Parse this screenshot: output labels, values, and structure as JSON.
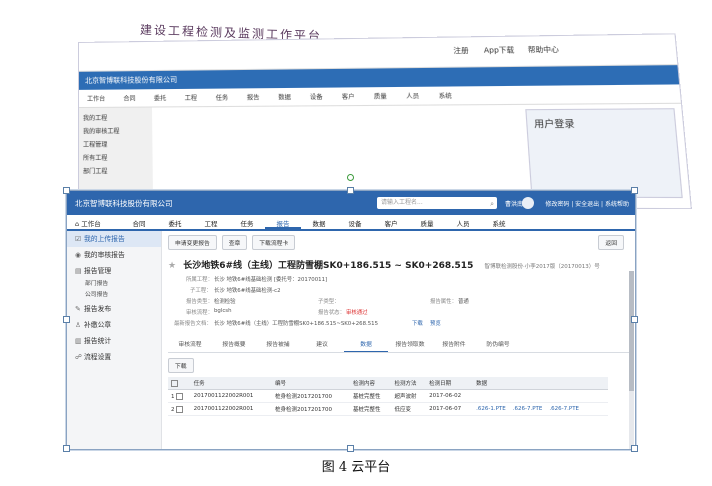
{
  "handwritten_title": "建设工程检测及监测工作平台",
  "background": {
    "company": "北京智博联科技股份有限公司",
    "top_links": [
      "注册",
      "App下载",
      "帮助中心"
    ],
    "nav": [
      "工作台",
      "合同",
      "委托",
      "工程",
      "任务",
      "报告",
      "数据",
      "设备",
      "客户",
      "质量",
      "人员",
      "系统"
    ],
    "side": [
      "我的工程",
      "我的审核工程",
      "工程管理",
      "所有工程",
      "部门工程"
    ],
    "login_title": "用户登录"
  },
  "app": {
    "company": "北京智博联科技股份有限公司",
    "search_placeholder": "请输入工程名...",
    "user": "曹洪南",
    "header_links": "修改密码 | 安全退出 | 系统帮助",
    "nav": [
      "工作台",
      "合同",
      "委托",
      "工程",
      "任务",
      "报告",
      "数据",
      "设备",
      "客户",
      "质量",
      "人员",
      "系统"
    ],
    "nav_active": "报告",
    "side": [
      {
        "label": "我的上传报告",
        "icon": "☑",
        "active": true
      },
      {
        "label": "我的审核报告",
        "icon": "◉"
      },
      {
        "label": "报告管理",
        "icon": "▤"
      },
      {
        "label": "部门报告",
        "sub": true
      },
      {
        "label": "公司报告",
        "sub": true
      },
      {
        "label": "报告发布",
        "icon": "✎"
      },
      {
        "label": "补缴公章",
        "icon": "♙"
      },
      {
        "label": "报告统计",
        "icon": "▥"
      },
      {
        "label": "流程设置",
        "icon": "☍"
      }
    ],
    "buttons": [
      "申请变更报告",
      "查章",
      "下载流程卡"
    ],
    "back_label": "返回",
    "title": "长沙地铁6#线（主线）工程防雪棚SK0+186.515 ~ SK0+268.515",
    "title_meta": "智博联检测股份·小李2017版（20170013）号",
    "info": {
      "project_label": "所属工程：",
      "project_value": "长沙 地铁6#线基础检测 [委托号：20170011]",
      "subproject_label": "子工程：",
      "subproject_value": "长沙 地铁6#线基础检测-c2",
      "type_label": "报告类型：",
      "type_value": "检测检验",
      "filetype_label": "子类型：",
      "attr_label": "报告属性：",
      "attr_value": "普通",
      "flow_label": "审核流程：",
      "flow_value": "bglcsh",
      "status_label": "报告状态：",
      "status_value": "审核通过",
      "file_label": "最新报告文档：",
      "file_value": "长沙 地铁6#线（主线）工程防雪棚SK0+186.515~SK0+268.515",
      "download": "下载",
      "preview": "预览"
    },
    "tabs": [
      "审核流程",
      "报告概要",
      "报告被捕",
      "建议",
      "数据",
      "报告领取数",
      "报告附件",
      "防伪编号"
    ],
    "tab_active": "数据",
    "download_btn": "下载",
    "table": {
      "headers": [
        "",
        "任务",
        "编号",
        "检测内容",
        "检测方法",
        "检测日期",
        "数据"
      ],
      "rows": [
        [
          "1",
          "2017001122002R001",
          "桩身检测2017201700",
          "基桩完整性",
          "超声波射",
          "2017-06-02",
          ""
        ],
        [
          "2",
          "2017001122002R001",
          "桩身检测2017201700",
          "基桩完整性",
          "低应变",
          "2017-06-07",
          ".626-1.PTE"
        ]
      ],
      "extra_links": [
        ".626-7.PTE",
        ".626-7.PTE"
      ]
    }
  },
  "caption": "图 4   云平台"
}
